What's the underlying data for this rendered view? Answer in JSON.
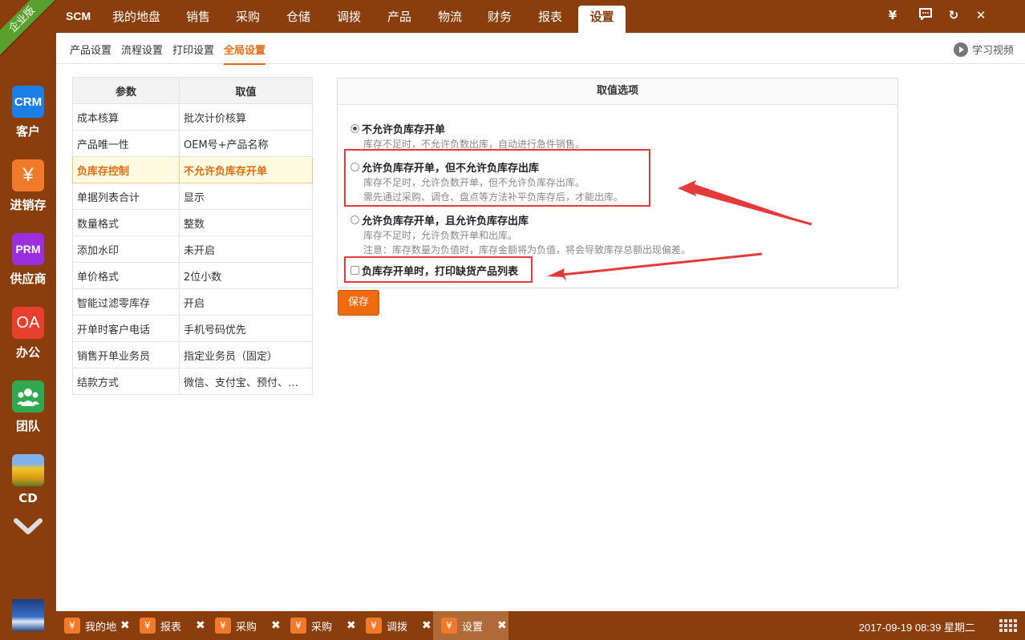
{
  "edition": "企业版",
  "brand": "SCM",
  "side_apps": [
    {
      "tile": "CRM",
      "label": "客户",
      "color": "#1a7fe6"
    },
    {
      "tile": "¥",
      "label": "进销存",
      "color": "#f07a2a"
    },
    {
      "tile": "PRM",
      "label": "供应商",
      "color": "#9b2fe0"
    },
    {
      "tile": "OA",
      "label": "办公",
      "color": "#e8402f"
    },
    {
      "tile": "",
      "label": "团队",
      "color": "#2fa84f"
    },
    {
      "tile": "",
      "label": "CD",
      "color": "#d9a21b"
    }
  ],
  "top_tabs": [
    "我的地盘",
    "销售",
    "采购",
    "仓储",
    "调拨",
    "产品",
    "物流",
    "财务",
    "报表",
    "设置"
  ],
  "top_active": "设置",
  "window_controls": {
    "currency": "¥",
    "chat": "▣",
    "refresh": "↻",
    "close": "✕"
  },
  "sub_tabs": [
    "产品设置",
    "流程设置",
    "打印设置",
    "全局设置"
  ],
  "sub_active": "全局设置",
  "help_video": "学习视频",
  "params_table": {
    "headers": [
      "参数",
      "取值"
    ],
    "rows": [
      [
        "成本核算",
        "批次计价核算"
      ],
      [
        "产品唯一性",
        "OEM号+产品名称"
      ],
      [
        "负库存控制",
        "不允许负库存开单"
      ],
      [
        "单据列表合计",
        "显示"
      ],
      [
        "数量格式",
        "整数"
      ],
      [
        "添加水印",
        "未开启"
      ],
      [
        "单价格式",
        "2位小数"
      ],
      [
        "智能过滤零库存",
        "开启"
      ],
      [
        "开单时客户电话",
        "手机号码优先"
      ],
      [
        "销售开单业务员",
        "指定业务员（固定）"
      ],
      [
        "结款方式",
        "微信、支付宝、预付、挂账"
      ]
    ],
    "selected_index": 2
  },
  "options_panel": {
    "header": "取值选项",
    "options": [
      {
        "title": "不允许负库存开单",
        "desc": [
          "库存不足时，不允许负数出库，自动进行急件销售。"
        ],
        "checked": true
      },
      {
        "title": "允许负库存开单，但不允许负库存出库",
        "desc": [
          "库存不足时，允许负数开单，但不允许负库存出库。",
          "需先通过采购、调仓、盘点等方法补平负库存后，才能出库。"
        ],
        "checked": false
      },
      {
        "title": "允许负库存开单，且允许负库存出库",
        "desc": [
          "库存不足时，允许负数开单和出库。",
          "注意：库存数量为负值时，库存金额将为负值，将会导致库存总额出现偏差。"
        ],
        "checked": false
      }
    ],
    "checkbox_label": "负库存开单时，打印缺货产品列表",
    "checkbox_checked": false
  },
  "save_label": "保存",
  "taskbar": {
    "tasks": [
      {
        "label": "我的地盘",
        "active": false
      },
      {
        "label": "报表",
        "active": false
      },
      {
        "label": "采购",
        "active": false
      },
      {
        "label": "采购",
        "active": false
      },
      {
        "label": "调拨",
        "active": false
      },
      {
        "label": "设置",
        "active": true
      }
    ],
    "task_icon": "¥",
    "close_glyph": "✖",
    "clock": "2017-09-19 08:39 星期二"
  },
  "colors": {
    "brand_brown": "#8a3d0d",
    "accent_orange": "#f06a10",
    "highlight_red": "#e33b3b"
  }
}
